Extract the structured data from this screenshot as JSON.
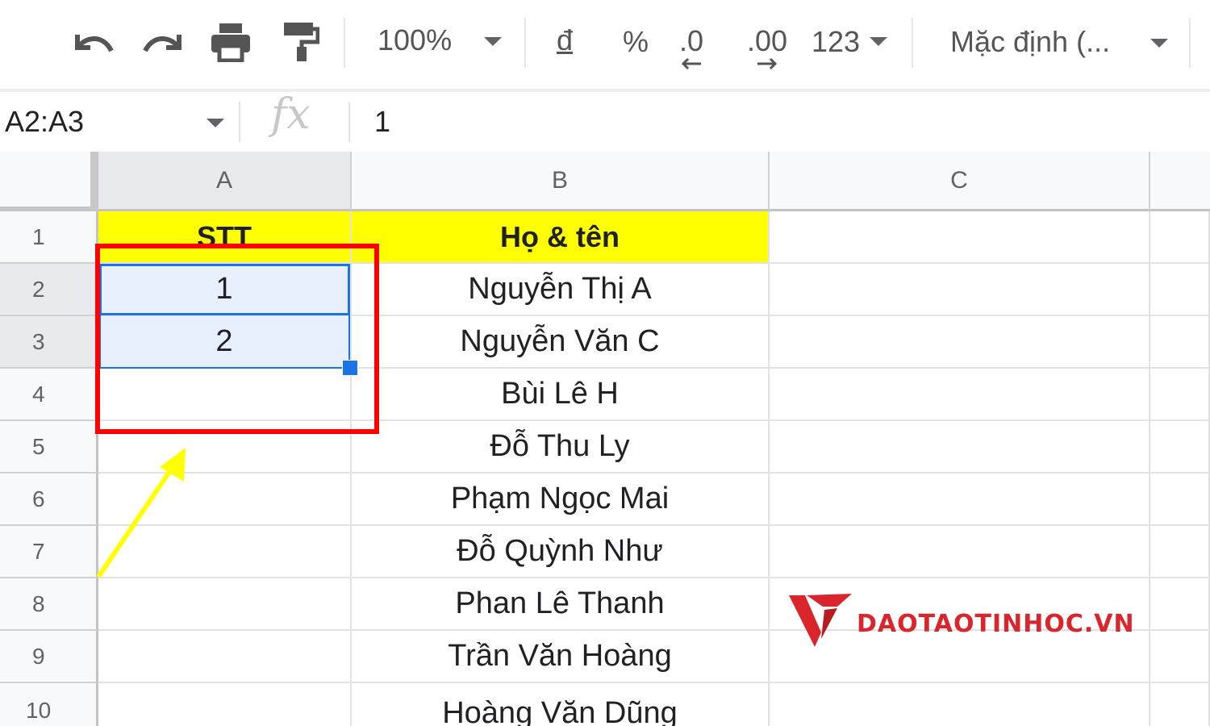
{
  "toolbar": {
    "zoom": "100%",
    "currency": "đ",
    "percent": "%",
    "decrease_decimal": ".0",
    "increase_decimal": ".00",
    "more_formats": "123",
    "font": "Mặc định (..."
  },
  "formula_bar": {
    "name_box": "A2:A3",
    "fx": "fx",
    "value": "1"
  },
  "columns": [
    "A",
    "B",
    "C"
  ],
  "rows": [
    {
      "num": "1",
      "a": "STT",
      "b": "Họ & tên"
    },
    {
      "num": "2",
      "a": "1",
      "b": "Nguyễn Thị A"
    },
    {
      "num": "3",
      "a": "2",
      "b": "Nguyễn Văn C"
    },
    {
      "num": "4",
      "a": "",
      "b": "Bùi Lê H"
    },
    {
      "num": "5",
      "a": "",
      "b": "Đỗ Thu Ly"
    },
    {
      "num": "6",
      "a": "",
      "b": "Phạm Ngọc Mai"
    },
    {
      "num": "7",
      "a": "",
      "b": "Đỗ Quỳnh Như"
    },
    {
      "num": "8",
      "a": "",
      "b": "Phan Lê Thanh"
    },
    {
      "num": "9",
      "a": "",
      "b": "Trần Văn Hoàng"
    },
    {
      "num": "10",
      "a": "",
      "b": "Hoàng Văn Dũng"
    }
  ],
  "watermark": {
    "text": "DAOTAOTINHOC.VN"
  },
  "colors": {
    "header_fill": "#ffff00",
    "selection": "#1a73e8",
    "annotation_box": "#ff0000",
    "annotation_arrow": "#ffff00",
    "brand": "#d9252b"
  }
}
